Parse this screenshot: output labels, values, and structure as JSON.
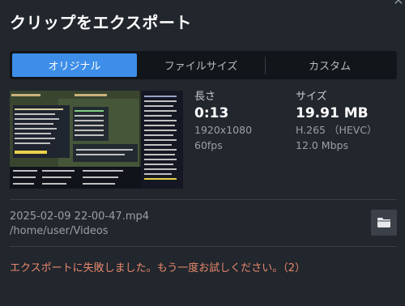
{
  "dialog": {
    "title": "クリップをエクスポート",
    "close_icon": "close-icon"
  },
  "tabs": [
    {
      "label": "オリジナル",
      "active": true
    },
    {
      "label": "ファイルサイズ",
      "active": false
    },
    {
      "label": "カスタム",
      "active": false
    }
  ],
  "info": {
    "length_label": "長さ",
    "length_value": "0:13",
    "resolution": "1920x1080",
    "fps": "60fps",
    "size_label": "サイズ",
    "size_value": "19.91 MB",
    "codec": "H.265 （HEVC）",
    "bitrate": "12.0 Mbps"
  },
  "file": {
    "name": "2025-02-09 22-00-47.mp4",
    "path": "/home/user/Videos",
    "folder_icon": "folder-icon"
  },
  "error_message": "エクスポートに失敗しました。もう一度お試しください。（2）",
  "colors": {
    "background": "#22262d",
    "tab_active": "#3d8ee8",
    "error": "#e8896c"
  }
}
